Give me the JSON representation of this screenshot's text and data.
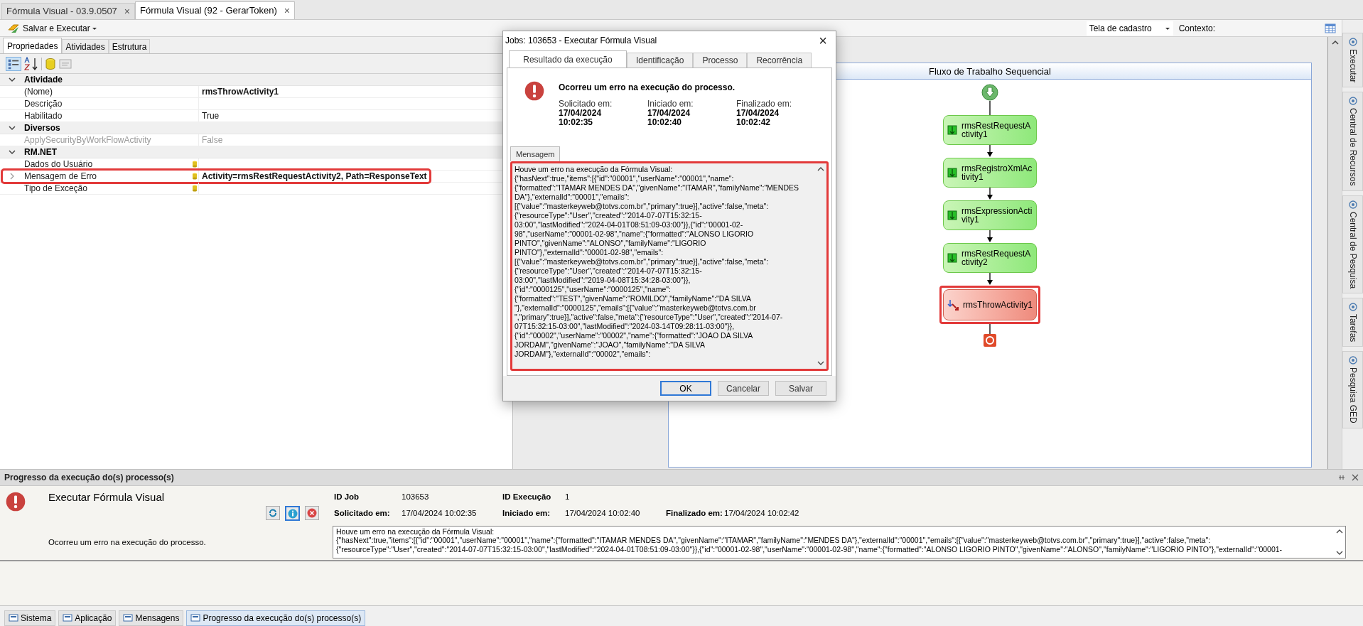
{
  "document_tabs": [
    {
      "label": "Fórmula Visual - 03.9.0507",
      "selected": false,
      "close": "×"
    },
    {
      "label": "Fórmula Visual (92 - GerarToken)",
      "selected": true,
      "close": "×"
    }
  ],
  "toolbar": {
    "run_button": "Salvar e Executar",
    "screen_select": "Tela de cadastro",
    "context_label": "Contexto:"
  },
  "panel_tabs": [
    {
      "label": "Propriedades",
      "selected": true
    },
    {
      "label": "Atividades",
      "selected": false
    },
    {
      "label": "Estrutura",
      "selected": false
    }
  ],
  "property_groups": [
    {
      "name": "Atividade",
      "expanded": true,
      "rows": [
        {
          "label": "(Nome)",
          "value": "rmsThrowActivity1",
          "bold": true,
          "disabled": false,
          "bound": false,
          "highlighted": false
        },
        {
          "label": "Descrição",
          "value": "",
          "disabled": false,
          "bound": false,
          "highlighted": false
        },
        {
          "label": "Habilitado",
          "value": "True",
          "bold": false,
          "disabled": false,
          "bound": false,
          "highlighted": false
        }
      ]
    },
    {
      "name": "Diversos",
      "expanded": true,
      "rows": [
        {
          "label": "ApplySecurityByWorkFlowActivity",
          "value": "False",
          "bold": false,
          "disabled": true,
          "bound": false,
          "highlighted": false
        }
      ]
    },
    {
      "name": "RM.NET",
      "expanded": true,
      "rows": [
        {
          "label": "Dados do Usuário",
          "value": "",
          "disabled": false,
          "bound": true,
          "highlighted": false
        },
        {
          "label": "Mensagem de Erro",
          "value": "Activity=rmsRestRequestActivity2, Path=ResponseText",
          "bold": true,
          "disabled": false,
          "bound": true,
          "highlighted": true
        },
        {
          "label": "Tipo de Exceção",
          "value": "",
          "disabled": false,
          "bound": true,
          "highlighted": false
        }
      ]
    }
  ],
  "workflow": {
    "title": "Fluxo de Trabalho Sequencial",
    "activities": [
      {
        "kind": "activity",
        "label": "rmsRestRequestActivity1",
        "highlighted": false
      },
      {
        "kind": "activity",
        "label": "rmsRegistroXmlActivity1",
        "highlighted": false
      },
      {
        "kind": "activity",
        "label": "rmsExpressionActivity1",
        "highlighted": false
      },
      {
        "kind": "activity",
        "label": "rmsRestRequestActivity2",
        "highlighted": false
      },
      {
        "kind": "throw",
        "label": "rmsThrowActivity1",
        "highlighted": true
      }
    ]
  },
  "side_tabs": [
    "Executar",
    "Central de Recursos",
    "Central de Pesquisa",
    "Tarefas",
    "Pesquisa GED"
  ],
  "dialog": {
    "title": "Jobs: 103653 - Executar Fórmula Visual",
    "close": "×",
    "tabs": [
      {
        "label": "Resultado da execução",
        "selected": true
      },
      {
        "label": "Identificação",
        "selected": false
      },
      {
        "label": "Processo",
        "selected": false
      },
      {
        "label": "Recorrência",
        "selected": false
      }
    ],
    "headline": "Ocorreu um erro na execução do processo.",
    "times": [
      {
        "label": "Solicitado em:",
        "date": "17/04/2024",
        "time": "10:02:35"
      },
      {
        "label": "Iniciado em:",
        "date": "17/04/2024",
        "time": "10:02:40"
      },
      {
        "label": "Finalizado em:",
        "date": "17/04/2024",
        "time": "10:02:42"
      }
    ],
    "message_tab": "Mensagem",
    "message_lines": [
      "Houve um erro na execução da Fórmula Visual:",
      "{\"hasNext\":true,\"items\":[{\"id\":\"00001\",\"userName\":\"00001\",\"name\":",
      "{\"formatted\":\"ITAMAR MENDES DA\",\"givenName\":\"ITAMAR\",\"familyName\":\"MENDES",
      "DA\"},\"externalId\":\"00001\",\"emails\":",
      "[{\"value\":\"masterkeyweb@totvs.com.br\",\"primary\":true}],\"active\":false,\"meta\":",
      "{\"resourceType\":\"User\",\"created\":\"2014-07-07T15:32:15-",
      "03:00\",\"lastModified\":\"2024-04-01T08:51:09-03:00\"}},{\"id\":\"00001-02-",
      "98\",\"userName\":\"00001-02-98\",\"name\":{\"formatted\":\"ALONSO LIGORIO",
      "PINTO\",\"givenName\":\"ALONSO\",\"familyName\":\"LIGORIO",
      "PINTO\"},\"externalId\":\"00001-02-98\",\"emails\":",
      "[{\"value\":\"masterkeyweb@totvs.com.br\",\"primary\":true}],\"active\":false,\"meta\":",
      "{\"resourceType\":\"User\",\"created\":\"2014-07-07T15:32:15-",
      "03:00\",\"lastModified\":\"2019-04-08T15:34:28-03:00\"}},",
      "{\"id\":\"0000125\",\"userName\":\"0000125\",\"name\":",
      "{\"formatted\":\"TEST\",\"givenName\":\"ROMILDO\",\"familyName\":\"DA SILVA",
      "\"},\"externalId\":\"0000125\",\"emails\":[{\"value\":\"masterkeyweb@totvs.com.br",
      "\",\"primary\":true}],\"active\":false,\"meta\":{\"resourceType\":\"User\",\"created\":\"2014-07-",
      "07T15:32:15-03:00\",\"lastModified\":\"2024-03-14T09:28:11-03:00\"}},",
      "{\"id\":\"00002\",\"userName\":\"00002\",\"name\":{\"formatted\":\"JOAO DA SILVA",
      "JORDAM\",\"givenName\":\"JOAO\",\"familyName\":\"DA SILVA",
      "JORDAM\"},\"externalId\":\"00002\",\"emails\":"
    ],
    "buttons": [
      {
        "label": "OK",
        "default": true
      },
      {
        "label": "Cancelar",
        "default": false
      },
      {
        "label": "Salvar",
        "default": false
      }
    ]
  },
  "progress_panel": {
    "title": "Progresso da execução do(s) processo(s)",
    "job": {
      "title": "Executar Fórmula Visual",
      "status": "Ocorreu um erro na execução do processo.",
      "fields": [
        {
          "label": "ID Job",
          "value": "103653"
        },
        {
          "label": "ID Execução",
          "value": "1"
        },
        {
          "label": "Solicitado em:",
          "value": "17/04/2024 10:02:35"
        },
        {
          "label": "Iniciado em:",
          "value": "17/04/2024 10:02:40"
        },
        {
          "label": "Finalizado em:",
          "value": "17/04/2024 10:02:42"
        }
      ],
      "message_lines": [
        "Houve um erro na execução da Fórmula Visual:",
        "{\"hasNext\":true,\"items\":[{\"id\":\"00001\",\"userName\":\"00001\",\"name\":{\"formatted\":\"ITAMAR MENDES DA\",\"givenName\":\"ITAMAR\",\"familyName\":\"MENDES DA\"},\"externalId\":\"00001\",\"emails\":[{\"value\":\"masterkeyweb@totvs.com.br\",\"primary\":true}],\"active\":false,\"meta\":",
        "{\"resourceType\":\"User\",\"created\":\"2014-07-07T15:32:15-03:00\",\"lastModified\":\"2024-04-01T08:51:09-03:00\"}},{\"id\":\"00001-02-98\",\"userName\":\"00001-02-98\",\"name\":{\"formatted\":\"ALONSO LIGORIO PINTO\",\"givenName\":\"ALONSO\",\"familyName\":\"LIGORIO PINTO\"},\"externalId\":\"00001-"
      ]
    }
  },
  "bottom_tabs": [
    {
      "label": "Sistema",
      "selected": false
    },
    {
      "label": "Aplicação",
      "selected": false
    },
    {
      "label": "Mensagens",
      "selected": false
    },
    {
      "label": "Progresso da execução do(s) processo(s)",
      "selected": true
    }
  ]
}
